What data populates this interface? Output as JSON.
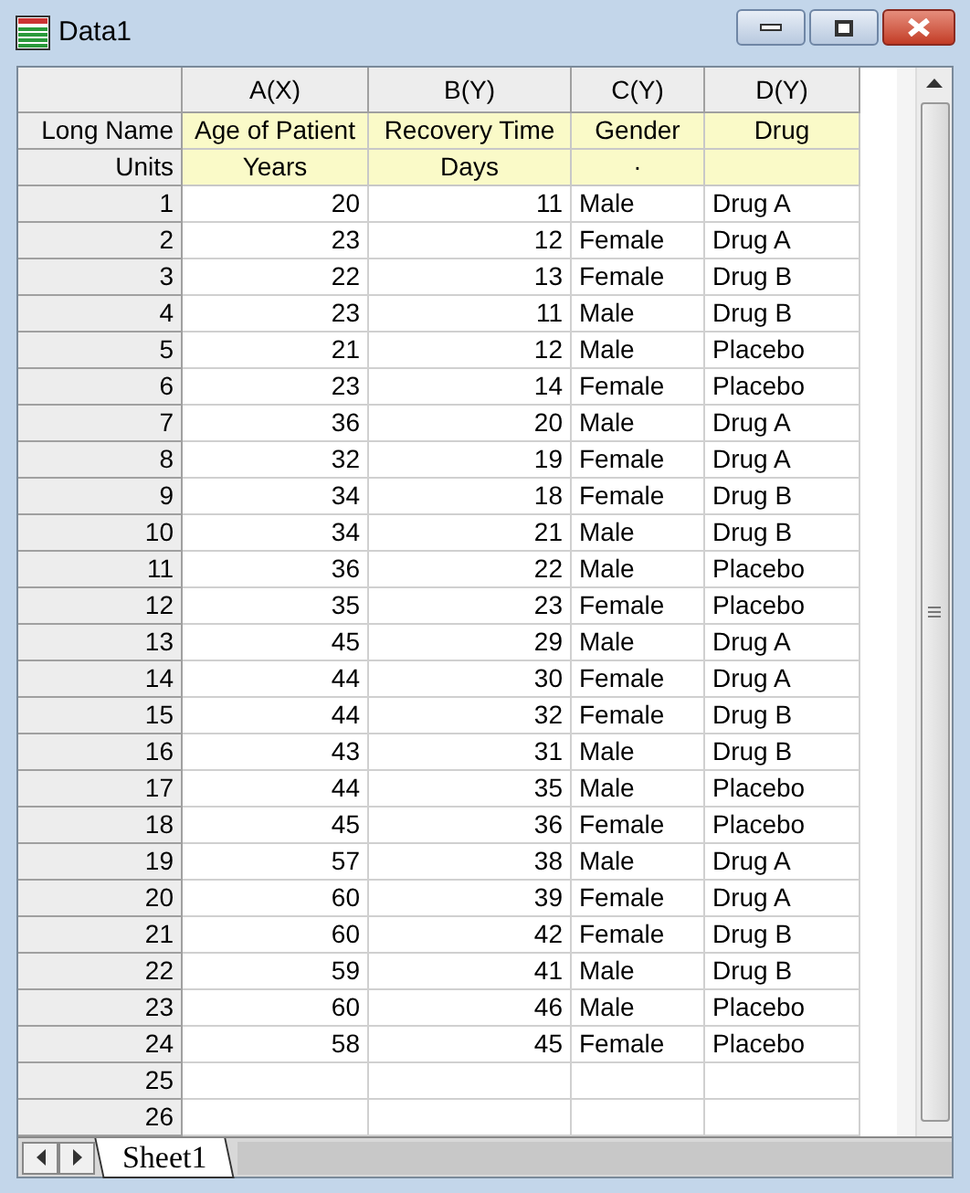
{
  "window": {
    "title": "Data1"
  },
  "header_labels": {
    "long_name": "Long Name",
    "units": "Units"
  },
  "columns": [
    {
      "name": "A(X)",
      "long_name": "Age of Patient",
      "units": "Years",
      "kind": "number"
    },
    {
      "name": "B(Y)",
      "long_name": "Recovery Time",
      "units": "Days",
      "kind": "number"
    },
    {
      "name": "C(Y)",
      "long_name": "Gender",
      "units": "·",
      "kind": "text"
    },
    {
      "name": "D(Y)",
      "long_name": "Drug",
      "kind": "text"
    }
  ],
  "rows": [
    {
      "number": "1",
      "cells": [
        "20",
        "11",
        "Male",
        "Drug A"
      ]
    },
    {
      "number": "2",
      "cells": [
        "23",
        "12",
        "Female",
        "Drug A"
      ]
    },
    {
      "number": "3",
      "cells": [
        "22",
        "13",
        "Female",
        "Drug B"
      ]
    },
    {
      "number": "4",
      "cells": [
        "23",
        "11",
        "Male",
        "Drug B"
      ]
    },
    {
      "number": "5",
      "cells": [
        "21",
        "12",
        "Male",
        "Placebo"
      ]
    },
    {
      "number": "6",
      "cells": [
        "23",
        "14",
        "Female",
        "Placebo"
      ]
    },
    {
      "number": "7",
      "cells": [
        "36",
        "20",
        "Male",
        "Drug A"
      ]
    },
    {
      "number": "8",
      "cells": [
        "32",
        "19",
        "Female",
        "Drug A"
      ]
    },
    {
      "number": "9",
      "cells": [
        "34",
        "18",
        "Female",
        "Drug B"
      ]
    },
    {
      "number": "10",
      "cells": [
        "34",
        "21",
        "Male",
        "Drug B"
      ]
    },
    {
      "number": "11",
      "cells": [
        "36",
        "22",
        "Male",
        "Placebo"
      ]
    },
    {
      "number": "12",
      "cells": [
        "35",
        "23",
        "Female",
        "Placebo"
      ]
    },
    {
      "number": "13",
      "cells": [
        "45",
        "29",
        "Male",
        "Drug A"
      ]
    },
    {
      "number": "14",
      "cells": [
        "44",
        "30",
        "Female",
        "Drug A"
      ]
    },
    {
      "number": "15",
      "cells": [
        "44",
        "32",
        "Female",
        "Drug B"
      ]
    },
    {
      "number": "16",
      "cells": [
        "43",
        "31",
        "Male",
        "Drug B"
      ]
    },
    {
      "number": "17",
      "cells": [
        "44",
        "35",
        "Male",
        "Placebo"
      ]
    },
    {
      "number": "18",
      "cells": [
        "45",
        "36",
        "Female",
        "Placebo"
      ]
    },
    {
      "number": "19",
      "cells": [
        "57",
        "38",
        "Male",
        "Drug A"
      ]
    },
    {
      "number": "20",
      "cells": [
        "60",
        "39",
        "Female",
        "Drug A"
      ]
    },
    {
      "number": "21",
      "cells": [
        "60",
        "42",
        "Female",
        "Drug B"
      ]
    },
    {
      "number": "22",
      "cells": [
        "59",
        "41",
        "Male",
        "Drug B"
      ]
    },
    {
      "number": "23",
      "cells": [
        "60",
        "46",
        "Male",
        "Placebo"
      ]
    },
    {
      "number": "24",
      "cells": [
        "58",
        "45",
        "Female",
        "Placebo"
      ]
    },
    {
      "number": "25",
      "cells": []
    },
    {
      "number": "26",
      "cells": []
    }
  ],
  "sheet_tab": {
    "label": "Sheet1"
  }
}
